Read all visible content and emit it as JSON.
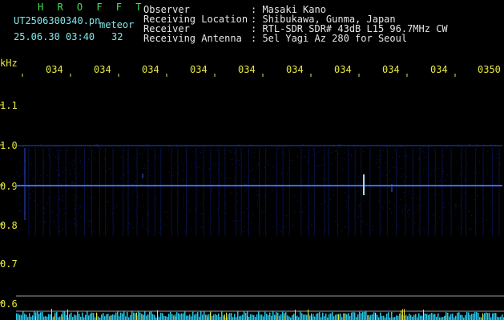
{
  "header": {
    "title": "H R O F F T",
    "filename": "UT2506300340.pn",
    "type": "meteor",
    "datetime": "25.06.30 03:40",
    "count": "32",
    "labels": {
      "observer": "Observer",
      "location": "Receiving Location",
      "receiver": "Receiver",
      "antenna": "Receiving Antenna"
    },
    "values": {
      "observer": ": Masaki Kano",
      "location": ": Shibukawa, Gunma, Japan",
      "receiver": ": RTL-SDR SDR# 43dB L15 96.7MHz CW",
      "antenna": ": 5el Yagi Az 280 for Seoul"
    }
  },
  "axis": {
    "unit": "kHz",
    "x_ticks": [
      "034",
      "034",
      "034",
      "034",
      "034",
      "034",
      "034",
      "034",
      "034",
      "0350"
    ],
    "y_ticks": [
      "1.1",
      "1.0",
      "0.9",
      "0.8",
      "0.7",
      "0.6"
    ]
  },
  "colors": {
    "trace": "#2f5cff",
    "bright_trace": "#9fdcff",
    "grid": "#9a9a9a",
    "tick": "#e8e83c",
    "histogram": "#26c6e8"
  }
}
